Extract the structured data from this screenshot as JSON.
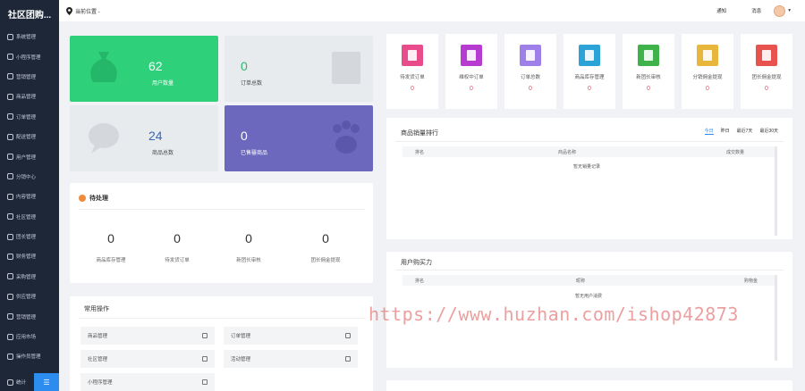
{
  "sidebar": {
    "logo": "社区团购...",
    "items": [
      {
        "label": "系统管理",
        "icon": "settings-icon"
      },
      {
        "label": "小程序管理",
        "icon": "link-icon"
      },
      {
        "label": "营销管理",
        "icon": "megaphone-icon"
      },
      {
        "label": "商品管理",
        "icon": "box-icon"
      },
      {
        "label": "订单管理",
        "icon": "order-icon"
      },
      {
        "label": "配送管理",
        "icon": "truck-icon"
      },
      {
        "label": "用户管理",
        "icon": "user-icon"
      },
      {
        "label": "分销中心",
        "icon": "share-icon"
      },
      {
        "label": "内容管理",
        "icon": "document-icon"
      },
      {
        "label": "社区管理",
        "icon": "community-icon"
      },
      {
        "label": "团长管理",
        "icon": "leader-icon"
      },
      {
        "label": "财务管理",
        "icon": "money-icon"
      },
      {
        "label": "采购管理",
        "icon": "cart-icon"
      },
      {
        "label": "供应管理",
        "icon": "supply-icon"
      },
      {
        "label": "营销管理",
        "icon": "gift-icon"
      },
      {
        "label": "应用市场",
        "icon": "app-icon"
      },
      {
        "label": "操作员管理",
        "icon": "operator-icon"
      }
    ],
    "footer_label": "统计"
  },
  "header": {
    "location": "当前位置 -",
    "notice": "通知",
    "message": "消息"
  },
  "stats": [
    {
      "value": "62",
      "label": "用户数量",
      "icon": "money-bag-icon"
    },
    {
      "value": "0",
      "label": "订单总数",
      "icon": "document-icon"
    },
    {
      "value": "24",
      "label": "商品总数",
      "icon": "chat-icon"
    },
    {
      "value": "0",
      "label": "已售罄商品",
      "icon": "paw-icon"
    }
  ],
  "pending": {
    "title": "待处理",
    "items": [
      {
        "value": "0",
        "label": "商品库存管理"
      },
      {
        "value": "0",
        "label": "待发货订单"
      },
      {
        "value": "0",
        "label": "新团长审核"
      },
      {
        "value": "0",
        "label": "团长佣金提现"
      }
    ]
  },
  "common_ops": {
    "title": "常用操作",
    "items": [
      {
        "label": "商品管理",
        "icon": "box-icon"
      },
      {
        "label": "订单管理",
        "icon": "calendar-icon"
      },
      {
        "label": "社区管理",
        "icon": "community-icon"
      },
      {
        "label": "活动管理",
        "icon": "tag-icon"
      },
      {
        "label": "小程序管理",
        "icon": "link-icon"
      }
    ]
  },
  "quick": [
    {
      "label": "待发货订单",
      "value": "0",
      "color": "#e84c8b",
      "icon": "document-icon"
    },
    {
      "label": "维权中订单",
      "value": "0",
      "color": "#b63bd1",
      "icon": "money-bag-icon"
    },
    {
      "label": "订单总数",
      "value": "0",
      "color": "#9f80e8",
      "icon": "truck-icon"
    },
    {
      "label": "商品库存管理",
      "value": "0",
      "color": "#2ba3d6",
      "icon": "clipboard-icon"
    },
    {
      "label": "新团长审核",
      "value": "0",
      "color": "#3fb24a",
      "icon": "notebook-icon"
    },
    {
      "label": "分销佣金提现",
      "value": "0",
      "color": "#e8b63a",
      "icon": "coins-icon"
    },
    {
      "label": "团长佣金提现",
      "value": "0",
      "color": "#e8524f",
      "icon": "wallet-icon"
    }
  ],
  "sales_rank": {
    "title": "商品销量排行",
    "tabs": [
      "今日",
      "昨日",
      "最近7天",
      "最近30天"
    ],
    "columns": [
      "排名",
      "商品名称",
      "成交数量"
    ],
    "empty": "暂无销量记录"
  },
  "user_rank": {
    "title": "用户购买力",
    "columns": [
      "排名",
      "昵称",
      "购物金"
    ],
    "empty": "暂无用户消费"
  },
  "watermark": "https://www.huzhan.com/ishop42873"
}
